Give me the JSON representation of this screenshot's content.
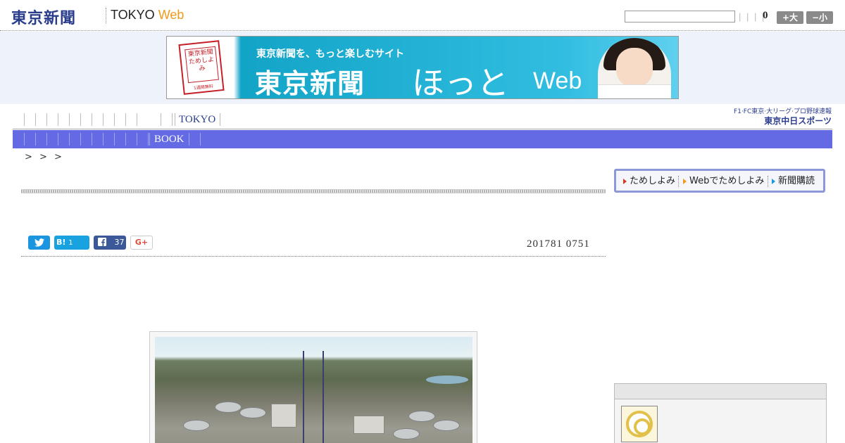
{
  "header": {
    "logo_main": "東京新聞",
    "logo_web_prefix": "TOKYO",
    "logo_web_suffix": "Web",
    "search_value": "",
    "mini_bars": "| | | |",
    "counter": "0",
    "size_big_label": "+大",
    "size_small_label": "−小"
  },
  "banner": {
    "book_title": "東京新聞ためしよみ",
    "book_footer": "1週間無料",
    "tagline": "東京新聞を、もっと楽しむサイト",
    "main_title": "東京新聞",
    "hot_text": "ほっと",
    "web_text": "Web"
  },
  "nav_primary": {
    "items": [
      "",
      "",
      "",
      "",
      "",
      "",
      "",
      "",
      "",
      "",
      "",
      "",
      "",
      "TOKYO",
      ""
    ]
  },
  "sports": {
    "line1": "F1·FC東京·大リーグ·プロ野球速報",
    "line2": "東京中日スポーツ"
  },
  "nav_secondary": {
    "items": [
      "",
      "",
      "",
      "",
      "",
      "",
      "",
      "",
      "",
      "",
      "",
      "",
      "BOOK",
      "",
      ""
    ]
  },
  "breadcrumb": "> > >",
  "share": {
    "hatena_label": "B!",
    "hatena_count": "1",
    "facebook_count": "37",
    "gplus_label": "G+"
  },
  "article": {
    "date": "201781 0751"
  },
  "sidebar": {
    "links": [
      "ためしよみ",
      "Webでためしよみ",
      "新聞購読"
    ]
  },
  "colors": {
    "brand_navy": "#2a3c8c",
    "web_orange": "#f09a1a",
    "nav_blue": "#636ae3",
    "twitter": "#1b95e0",
    "facebook": "#3b5998",
    "gplus": "#dd4b39"
  },
  "icons": {
    "twitter": "twitter-icon",
    "hatena": "hatena-bookmark-icon",
    "facebook": "facebook-icon",
    "gplus": "google-plus-icon",
    "target": "target-icon"
  }
}
